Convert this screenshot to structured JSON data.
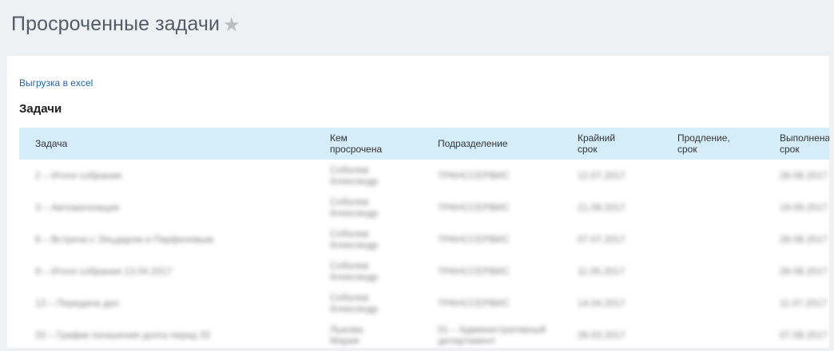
{
  "header": {
    "title": "Просроченные задачи",
    "favorite_icon": "star-icon"
  },
  "panel": {
    "export_label": "Выгрузка в excel",
    "section_title": "Задачи"
  },
  "table": {
    "columns": [
      {
        "line1": "Задача",
        "line2": ""
      },
      {
        "line1": "Кем",
        "line2": "просрочена"
      },
      {
        "line1": "Подразделение",
        "line2": ""
      },
      {
        "line1": "Крайний",
        "line2": "срок"
      },
      {
        "line1": "Продление,",
        "line2": "срок"
      },
      {
        "line1": "Выполнена,",
        "line2": "срок"
      }
    ],
    "rows": [
      {
        "task": "2 – Итоги собрания",
        "by_1": "Соболев",
        "by_2": "Александр",
        "dept_1": "ТРАНССЕРВИС",
        "dept_2": "",
        "deadline": "12.07.2017",
        "extension": "",
        "done": "28.08.2017"
      },
      {
        "task": "3 – Автоматизация",
        "by_1": "Соболев",
        "by_2": "Александр",
        "dept_1": "ТРАНССЕРВИС",
        "dept_2": "",
        "deadline": "21.08.2017",
        "extension": "",
        "done": "19.09.2017"
      },
      {
        "task": "8 – Встреча с Эльдаром и Парфеновым",
        "by_1": "Соболев",
        "by_2": "Александр",
        "dept_1": "ТРАНССЕРВИС",
        "dept_2": "",
        "deadline": "07.07.2017",
        "extension": "",
        "done": "28.08.2017"
      },
      {
        "task": "9 – Итоги собрания 13.04.2017",
        "by_1": "Соболев",
        "by_2": "Александр",
        "dept_1": "ТРАНССЕРВИС",
        "dept_2": "",
        "deadline": "11.05.2017",
        "extension": "",
        "done": "28.08.2017"
      },
      {
        "task": "13 – Передача дел",
        "by_1": "Соболев",
        "by_2": "Александр",
        "dept_1": "ТРАНССЕРВИС",
        "dept_2": "",
        "deadline": "14.04.2017",
        "extension": "",
        "done": "11.07.2017"
      },
      {
        "task": "33 – График погашения долга перед 33",
        "by_1": "Лыкова",
        "by_2": "Мария",
        "dept_1": "01 – Административный",
        "dept_2": "департамент",
        "deadline": "28.03.2017",
        "extension": "",
        "done": "07.08.2017"
      }
    ]
  },
  "colors": {
    "background": "#eef1f4",
    "panel": "#ffffff",
    "table_header": "#d5edf8",
    "link": "#2067b0",
    "title": "#535c69"
  }
}
